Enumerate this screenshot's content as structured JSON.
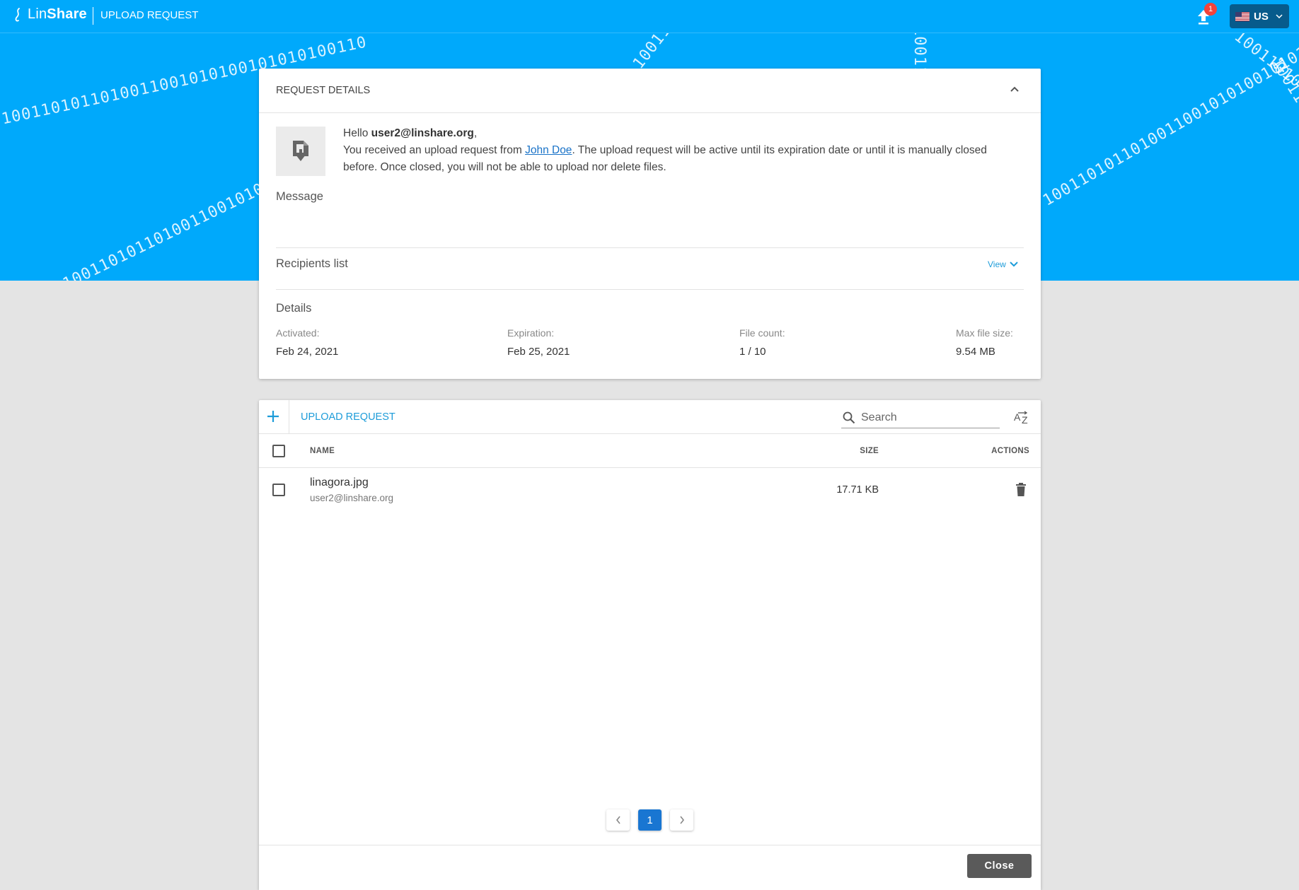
{
  "header": {
    "logo_light": "Lin",
    "logo_bold": "Share",
    "page_label": "UPLOAD REQUEST",
    "notification_count": "1",
    "language": "US"
  },
  "hero": {
    "binary_text": "1001101011010011001010100101010100110"
  },
  "request_details": {
    "title": "REQUEST DETAILS",
    "greeting_prefix": "Hello ",
    "recipient": "user2@linshare.org",
    "greeting_suffix": ",",
    "intro_text": "You received an upload request from ",
    "sender": "John Doe",
    "info_text": ". The upload request will be active until its expiration date or until it is manually closed before. Once closed, you will not be able to upload nor delete files.",
    "message_label": "Message",
    "recipients_label": "Recipients list",
    "view_label": "View",
    "details_label": "Details",
    "details": [
      {
        "label": "Activated:",
        "value": "Feb 24, 2021"
      },
      {
        "label": "Expiration:",
        "value": "Feb 25, 2021"
      },
      {
        "label": "File count:",
        "value": "1 / 10"
      },
      {
        "label": "Max file size:",
        "value": "9.54 MB"
      }
    ]
  },
  "files": {
    "title": "UPLOAD REQUEST",
    "search_placeholder": "Search",
    "columns": {
      "name": "NAME",
      "size": "SIZE",
      "actions": "ACTIONS"
    },
    "rows": [
      {
        "name": "linagora.jpg",
        "owner": "user2@linshare.org",
        "size": "17.71 KB"
      }
    ],
    "pagination": {
      "current": "1"
    },
    "close_label": "Close"
  },
  "colors": {
    "brand": "#00a9fb",
    "accent_text": "#1d9cd9",
    "pager_active": "#1976d2",
    "badge": "#f4433a",
    "lang_button": "#075b8c"
  }
}
